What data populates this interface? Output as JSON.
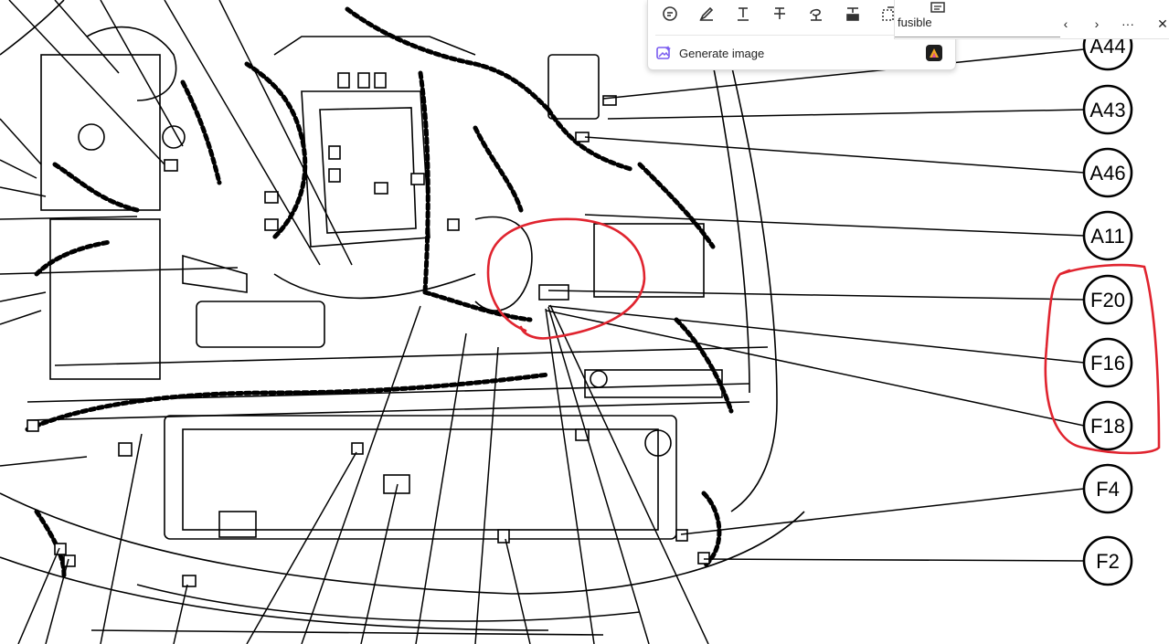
{
  "toolbar": {
    "tools": [
      "comment-icon",
      "highlight-pen-icon",
      "text-icon",
      "strikethrough-icon",
      "signature-icon",
      "redact-icon",
      "select-area-icon"
    ],
    "generate_label": "Generate image",
    "accent": "#7a5cf0"
  },
  "findbar": {
    "query": "fusible",
    "prev_label": "‹",
    "next_label": "›",
    "more_label": "···",
    "close_label": "✕"
  },
  "diagram": {
    "callouts": [
      {
        "id": "a44",
        "label": "A44"
      },
      {
        "id": "a43",
        "label": "A43"
      },
      {
        "id": "a46",
        "label": "A46"
      },
      {
        "id": "a11",
        "label": "A11"
      },
      {
        "id": "f20",
        "label": "F20"
      },
      {
        "id": "f16",
        "label": "F16"
      },
      {
        "id": "f18",
        "label": "F18"
      },
      {
        "id": "f4",
        "label": "F4"
      },
      {
        "id": "f2",
        "label": "F2"
      }
    ],
    "annotation_color": "#e0242f"
  }
}
